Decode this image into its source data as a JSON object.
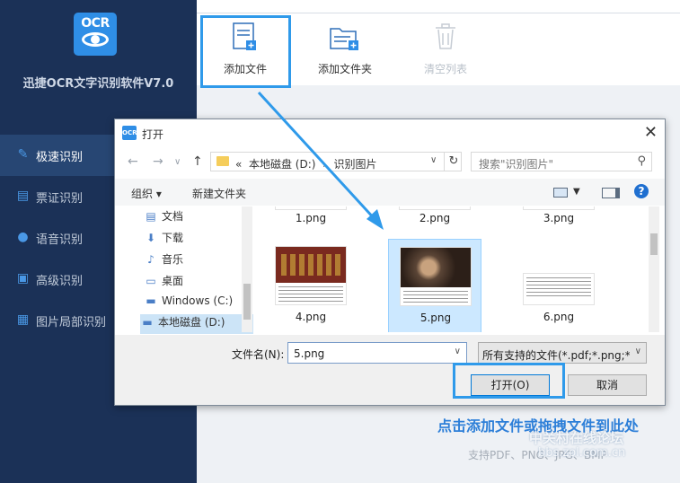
{
  "app": {
    "name": "迅捷OCR文字识别软件V7.0",
    "logo_text": "OCR",
    "brand_color": "#2f8ee6",
    "sidebar_bg": "#1b3157"
  },
  "sidebar": {
    "items": [
      {
        "label": "极速识别",
        "icon": "quick-ocr-icon",
        "active": true
      },
      {
        "label": "票证识别",
        "icon": "ticket-icon",
        "active": false
      },
      {
        "label": "语音识别",
        "icon": "microphone-icon",
        "active": false
      },
      {
        "label": "高级识别",
        "icon": "advanced-scan-icon",
        "active": false
      },
      {
        "label": "图片局部识别",
        "icon": "crop-icon",
        "active": false
      }
    ]
  },
  "toolbar": {
    "add_file": "添加文件",
    "add_folder": "添加文件夹",
    "clear_list": "清空列表"
  },
  "main": {
    "hint": "点击添加文件或拖拽文件到此处",
    "support": "支持PDF、PNG、JPG、BMP"
  },
  "watermark": {
    "line1": "中关村在线论坛",
    "line2": "bbs.zol.com.cn"
  },
  "dialog": {
    "title": "打开",
    "title_icon_text": "OCR",
    "path_prefix": "«",
    "path_drive": "本地磁盘 (D:)",
    "path_sep": "›",
    "path_folder": "识别图片",
    "search_placeholder": "搜索\"识别图片\"",
    "organize": "组织 ▾",
    "new_folder": "新建文件夹",
    "tree": [
      {
        "label": "文档",
        "icon": "document-icon"
      },
      {
        "label": "下载",
        "icon": "download-icon"
      },
      {
        "label": "音乐",
        "icon": "music-icon"
      },
      {
        "label": "桌面",
        "icon": "desktop-icon"
      },
      {
        "label": "Windows (C:)",
        "icon": "drive-icon"
      },
      {
        "label": "本地磁盘 (D:)",
        "icon": "drive-icon",
        "selected": true
      }
    ],
    "files": [
      {
        "name": "1.png"
      },
      {
        "name": "2.png"
      },
      {
        "name": "3.png"
      },
      {
        "name": "4.png"
      },
      {
        "name": "5.png",
        "selected": true
      },
      {
        "name": "6.png"
      }
    ],
    "filename_label": "文件名(N):",
    "filename_value": "5.png",
    "filter_value": "所有支持的文件(*.pdf;*.png;*.j",
    "open_button": "打开(O)",
    "cancel_button": "取消"
  }
}
